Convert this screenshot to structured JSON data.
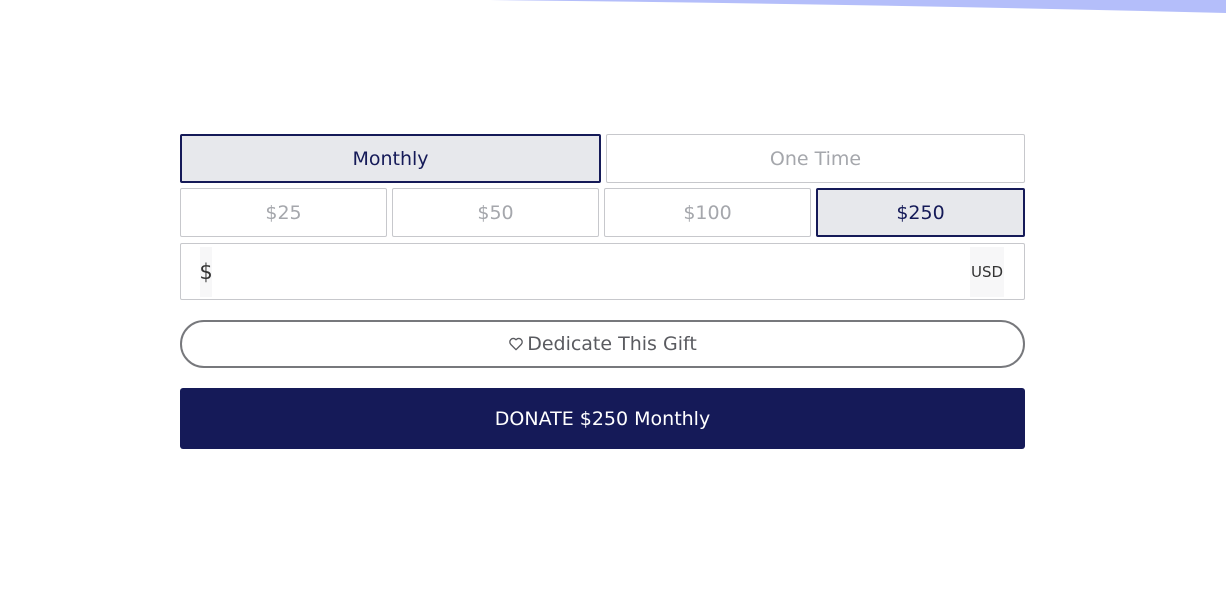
{
  "colors": {
    "accent": "#151a58",
    "selected_background": "#e7e8ec",
    "unselected_text": "#a5a7ac",
    "border": "#c7c8cc",
    "top_decoration": "#b4befa"
  },
  "frequency": {
    "options": [
      {
        "label": "Monthly",
        "selected": true
      },
      {
        "label": "One Time",
        "selected": false
      }
    ]
  },
  "amounts": {
    "options": [
      {
        "label": "$25",
        "selected": false
      },
      {
        "label": "$50",
        "selected": false
      },
      {
        "label": "$100",
        "selected": false
      },
      {
        "label": "$250",
        "selected": true
      }
    ]
  },
  "custom_amount": {
    "currency_symbol": "$",
    "value": "",
    "currency_code": "USD"
  },
  "dedicate": {
    "icon": "heart-outline-icon",
    "label": "Dedicate This Gift"
  },
  "donate": {
    "label": "DONATE $250 Monthly"
  }
}
